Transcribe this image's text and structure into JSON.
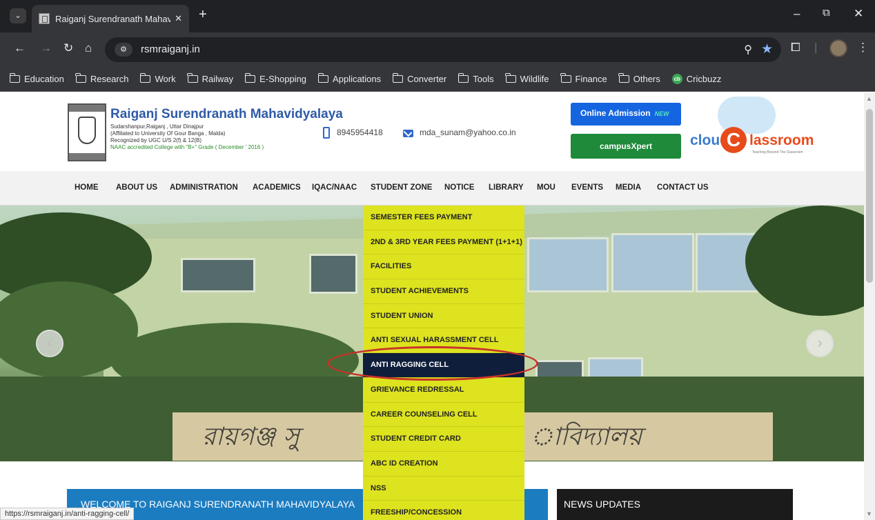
{
  "browser": {
    "tab_title": "Raiganj Surendranath Mahavid",
    "url": "rsmraiganj.in",
    "bookmarks": [
      {
        "label": "Education",
        "icon": "folder-icon"
      },
      {
        "label": "Research",
        "icon": "folder-icon"
      },
      {
        "label": "Work",
        "icon": "folder-icon"
      },
      {
        "label": "Railway",
        "icon": "folder-icon"
      },
      {
        "label": "E-Shopping",
        "icon": "folder-icon"
      },
      {
        "label": "Applications",
        "icon": "folder-icon"
      },
      {
        "label": "Converter",
        "icon": "folder-icon"
      },
      {
        "label": "Tools",
        "icon": "folder-icon"
      },
      {
        "label": "Wildlife",
        "icon": "folder-icon"
      },
      {
        "label": "Finance",
        "icon": "folder-icon"
      },
      {
        "label": "Others",
        "icon": "folder-icon"
      },
      {
        "label": "Cricbuzz",
        "icon": "cricbuzz-icon"
      }
    ],
    "status_url": "https://rsmraiganj.in/anti-ragging-cell/"
  },
  "header": {
    "college_name": "Raiganj Surendranath Mahavidyalaya",
    "address": "Sudarshanpur,Raiganj , Uttar Dinajpur",
    "affiliation": "(Affiliated to University Of Gour Banga , Malda)",
    "recognition": "Recognized by UGC U/S 2(f) & 12(B)",
    "naac": "NAAC accredited College with \"B+\" Grade ( December ' 2016 )",
    "phone": "8945954418",
    "email": "mda_sunam@yahoo.co.in",
    "admission_button": "Online Admission",
    "new_badge": "NEW",
    "campus_button": "campusXpert",
    "cloud_prefix": "cloud",
    "cloud_c": "C",
    "cloud_suffix": "lassroom",
    "cloud_tagline": "Teaching Beyond The Classroom"
  },
  "nav": {
    "items": [
      "HOME",
      "ABOUT US",
      "ADMINISTRATION",
      "ACADEMICS",
      "IQAC/NAAC",
      "STUDENT ZONE",
      "NOTICE",
      "LIBRARY",
      "MOU",
      "EVENTS",
      "MEDIA",
      "CONTACT US"
    ]
  },
  "dropdown": {
    "items": [
      "SEMESTER FEES PAYMENT",
      "2ND & 3RD YEAR FEES PAYMENT (1+1+1)",
      "FACILITIES",
      "STUDENT ACHIEVEMENTS",
      "STUDENT UNION",
      "ANTI SEXUAL HARASSMENT CELL",
      "ANTI RAGGING CELL",
      "GRIEVANCE REDRESSAL",
      "CAREER COUNSELING CELL",
      "STUDENT CREDIT CARD",
      "ABC ID CREATION",
      "NSS",
      "FREESHIP/CONCESSION"
    ],
    "active_index": 6
  },
  "hero": {
    "sign_part1": "রায়গঞ্জ সু",
    "sign_part2": "াবিদ্যালয়",
    "prev_symbol": "‹",
    "next_symbol": "›"
  },
  "welcome": {
    "prefix": "WELCOME TO ",
    "highlight": "RAIGANJ SURENDRANATH MAHAVIDYALAYA"
  },
  "news": {
    "title": "NEWS UPDATES"
  },
  "colors": {
    "dropdown_bg": "#dde31e",
    "active_item_bg": "#0f1e3b",
    "annotation_circle": "#c8312b",
    "welcome_bg": "#1c7cc0",
    "brand_blue": "#2e5aa8"
  }
}
